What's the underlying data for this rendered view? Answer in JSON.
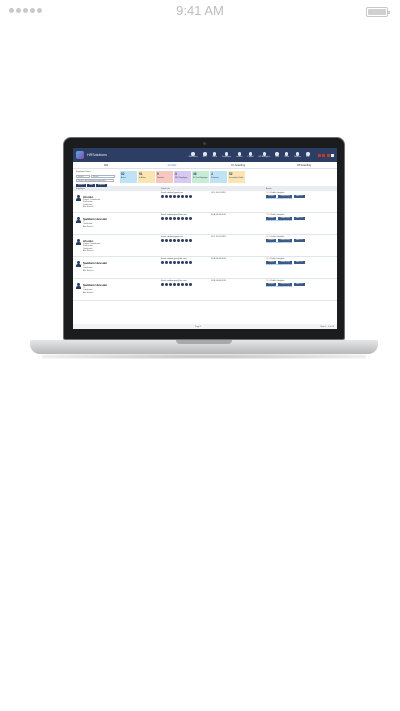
{
  "status_bar": {
    "time": "9:41 AM",
    "signal": "signal-dots-icon",
    "battery": "battery-icon"
  },
  "app": {
    "brand": "HRSolutions",
    "nav": [
      {
        "label": "Workforce",
        "icon": "workforce-icon"
      },
      {
        "label": "BPO",
        "icon": "bpo-icon"
      },
      {
        "label": "Office",
        "icon": "office-icon"
      },
      {
        "label": "Employee",
        "icon": "employee-icon"
      },
      {
        "label": "Leaves",
        "icon": "leaves-icon"
      },
      {
        "label": "Payroll",
        "icon": "payroll-icon"
      },
      {
        "label": "HR Analytics",
        "icon": "analytics-icon"
      },
      {
        "label": "Task",
        "icon": "task-icon"
      },
      {
        "label": "Team",
        "icon": "team-icon"
      },
      {
        "label": "Reports",
        "icon": "reports-icon"
      },
      {
        "label": "Ext",
        "icon": "ext-icon"
      }
    ],
    "tabs": [
      "N/A",
      "Current",
      "On boarding",
      "Off boarding"
    ],
    "filters": {
      "employee_label": "Employee Name",
      "select1": "Select",
      "select2": "Select",
      "search_placeholder": "Search by employee/name/role",
      "buttons": [
        "Search",
        "Add",
        "Reports"
      ]
    },
    "cards": [
      {
        "value": "52",
        "label": "Active",
        "color": "#bfe3f5"
      },
      {
        "value": "91",
        "label": "In Active",
        "color": "#fce5b3"
      },
      {
        "value": "0",
        "label": "Deactive",
        "color": "#f7c8c0"
      },
      {
        "value": "3",
        "label": "NDC Employee",
        "color": "#d7c9ef"
      },
      {
        "value": "46",
        "label": "ID Card Employee",
        "color": "#c9ecd6"
      },
      {
        "value": "4",
        "label": "Probation",
        "color": "#bfe3f5"
      },
      {
        "value": "52",
        "label": "Incomplete Profile",
        "color": "#fce5b3"
      }
    ],
    "table_headers": [
      "Employee",
      "Detail info",
      "Action"
    ],
    "rows": [
      {
        "name": "Aloobo",
        "role": "Project Coordinator",
        "team": "Production",
        "status": "Confirmed",
        "branch": "Abc Branch",
        "email": "Email: aloobo@gmail.com",
        "dob": "DOJ: 01-07-2018",
        "pct": "76%",
        "profile": "Profile Complete"
      },
      {
        "name": "Saddam Hussain",
        "role": "IT",
        "team": "Confirmed",
        "status": "",
        "branch": "Abc Branch",
        "email": "Email: saddam.gsm@abc.com",
        "dob": "DOB: 06-06-2016",
        "pct": "76%",
        "profile": "Profile Complete"
      },
      {
        "name": "Aloobo",
        "role": "Project Coordinator",
        "team": "Production",
        "status": "Confirmed",
        "branch": "Abc Branch",
        "email": "Email: aloobo@gmail.com",
        "dob": "DOJ: 01-07-2018",
        "pct": "76%",
        "profile": "Profile Complete"
      },
      {
        "name": "Saddam Hussain",
        "role": "IT",
        "team": "Confirmed",
        "status": "",
        "branch": "Abc Branch",
        "email": "Email: saddam.gsm@abc.com",
        "dob": "DOB: 06-06-2016",
        "pct": "76%",
        "profile": "Profile Complete"
      },
      {
        "name": "Saddam Hussain",
        "role": "IT",
        "team": "Confirmed",
        "status": "",
        "branch": "Abc Branch",
        "email": "Email: saddam.gsm@abc.com",
        "dob": "DOB: 06-06-2016",
        "pct": "76%",
        "profile": "Profile Complete"
      }
    ],
    "row_actions": [
      "Contact",
      "Credit Entry",
      "View CV"
    ],
    "row_links": [
      "Send ESS Password",
      "click here"
    ],
    "pager": {
      "page_label": "Page",
      "page": "1",
      "count": "View 1 - 1 of 50"
    }
  }
}
